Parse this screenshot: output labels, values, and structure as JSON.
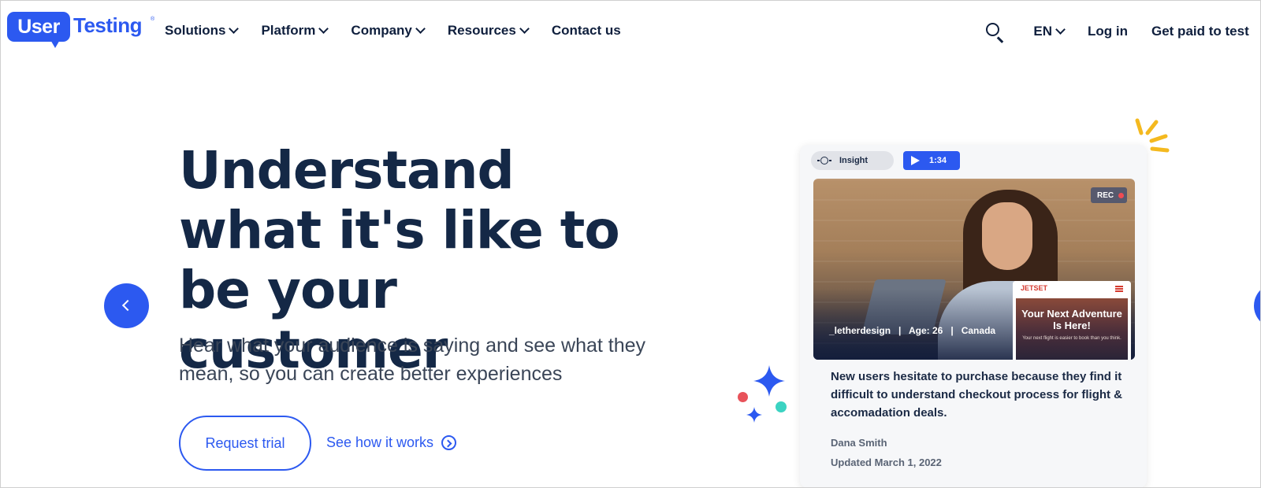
{
  "logo": {
    "part1": "User",
    "part2": "Testing",
    "tm": "®"
  },
  "nav": {
    "items": [
      {
        "label": "Solutions",
        "dropdown": true
      },
      {
        "label": "Platform",
        "dropdown": true
      },
      {
        "label": "Company",
        "dropdown": true
      },
      {
        "label": "Resources",
        "dropdown": true
      },
      {
        "label": "Contact us",
        "dropdown": false
      }
    ],
    "language": "EN",
    "login": "Log in",
    "get_paid": "Get paid to test"
  },
  "hero": {
    "headline": "Understand what it's like to be your customer",
    "subhead": "Hear what your audience is saying and see what they mean, so you can create better experiences",
    "primary_button": "Request trial",
    "secondary_link": "See how it works"
  },
  "card": {
    "insight_label": "Insight",
    "video_time": "1:34",
    "rec_label": "REC",
    "participant": "_letherdesign",
    "age": "Age: 26",
    "country": "Canada",
    "phone": {
      "brand": "JETSET",
      "title": "Your Next Adventure Is Here!",
      "sub": "Your next flight is easier to book than you think."
    },
    "insight_text": "New users hesitate to purchase because they find it difficult to understand checkout process for flight & accomadation deals.",
    "author": "Dana Smith",
    "updated": "Updated March 1, 2022"
  },
  "colors": {
    "accent": "#2c59f0",
    "heading": "#142846",
    "body": "#3a4557"
  },
  "icons": [
    "search-icon",
    "chevron-down-icon",
    "chevron-left-icon",
    "arrow-circle-right-icon",
    "lightbulb-icon",
    "play-icon",
    "rec-dot-icon",
    "sparkle-icon",
    "rays-icon",
    "menu-icon"
  ]
}
